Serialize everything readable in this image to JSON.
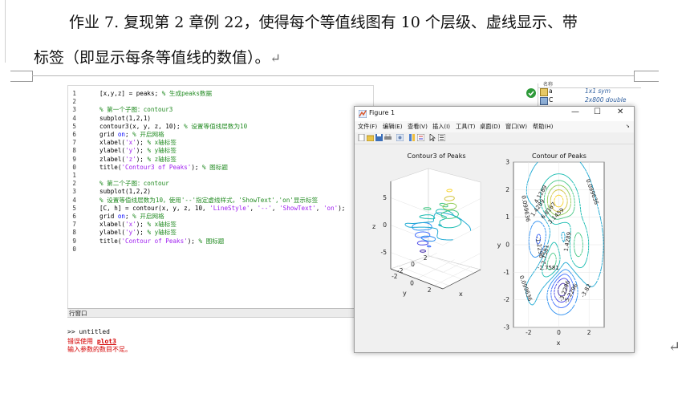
{
  "document": {
    "line1": "作业 7.  复现第 2 章例 22，使得每个等值线图有 10 个层级、虚线显示、带",
    "line2": "标签（即显示每条等值线的数值）。",
    "enter_mark": "↵"
  },
  "editor": {
    "lines": [
      {
        "n": "1",
        "parts": [
          [
            "t",
            "[x,y,z] = peaks; "
          ],
          [
            "c",
            "% 生成peaks数据"
          ]
        ]
      },
      {
        "n": "2",
        "parts": []
      },
      {
        "n": "3",
        "parts": [
          [
            "c",
            "% 第一个子图：contour3"
          ]
        ]
      },
      {
        "n": "4",
        "parts": [
          [
            "t",
            "subplot(1,2,1)"
          ]
        ]
      },
      {
        "n": "5",
        "parts": [
          [
            "t",
            "contour3(x, y, z, 10); "
          ],
          [
            "c",
            "% 设置等值线层数为10"
          ]
        ]
      },
      {
        "n": "6",
        "parts": [
          [
            "t",
            "grid "
          ],
          [
            "k",
            "on"
          ],
          [
            "t",
            "; "
          ],
          [
            "c",
            "% 开启网格"
          ]
        ]
      },
      {
        "n": "7",
        "parts": [
          [
            "t",
            "xlabel("
          ],
          [
            "s",
            "'x'"
          ],
          [
            "t",
            "); "
          ],
          [
            "c",
            "% x轴标签"
          ]
        ]
      },
      {
        "n": "8",
        "parts": [
          [
            "t",
            "ylabel("
          ],
          [
            "s",
            "'y'"
          ],
          [
            "t",
            "); "
          ],
          [
            "c",
            "% y轴标签"
          ]
        ]
      },
      {
        "n": "9",
        "parts": [
          [
            "t",
            "zlabel("
          ],
          [
            "s",
            "'z'"
          ],
          [
            "t",
            "); "
          ],
          [
            "c",
            "% z轴标签"
          ]
        ]
      },
      {
        "n": "0",
        "parts": [
          [
            "t",
            "title("
          ],
          [
            "s",
            "'Contour3 of Peaks'"
          ],
          [
            "t",
            "); "
          ],
          [
            "c",
            "% 图标题"
          ]
        ]
      },
      {
        "n": "1",
        "parts": []
      },
      {
        "n": "2",
        "parts": [
          [
            "c",
            "% 第二个子图：contour"
          ]
        ]
      },
      {
        "n": "3",
        "parts": [
          [
            "t",
            "subplot(1,2,2)"
          ]
        ]
      },
      {
        "n": "4",
        "parts": [
          [
            "c",
            "% 设置等值线层数为10，使用'--'指定虚线样式，'ShowText','on'显示标签"
          ]
        ]
      },
      {
        "n": "5",
        "parts": [
          [
            "t",
            "[C, h] = contour(x, y, z, 10, "
          ],
          [
            "s",
            "'LineStyle'"
          ],
          [
            "t",
            ", "
          ],
          [
            "s",
            "'--'"
          ],
          [
            "t",
            ", "
          ],
          [
            "s",
            "'ShowText'"
          ],
          [
            "t",
            ", "
          ],
          [
            "s",
            "'on'"
          ],
          [
            "t",
            ");"
          ]
        ]
      },
      {
        "n": "6",
        "parts": [
          [
            "t",
            "grid "
          ],
          [
            "k",
            "on"
          ],
          [
            "t",
            "; "
          ],
          [
            "c",
            "% 开启网格"
          ]
        ]
      },
      {
        "n": "7",
        "parts": [
          [
            "t",
            "xlabel("
          ],
          [
            "s",
            "'x'"
          ],
          [
            "t",
            "); "
          ],
          [
            "c",
            "% x轴标签"
          ]
        ]
      },
      {
        "n": "8",
        "parts": [
          [
            "t",
            "ylabel("
          ],
          [
            "s",
            "'y'"
          ],
          [
            "t",
            "); "
          ],
          [
            "c",
            "% y轴标签"
          ]
        ]
      },
      {
        "n": "9",
        "parts": [
          [
            "t",
            "title("
          ],
          [
            "s",
            "'Contour of Peaks'"
          ],
          [
            "t",
            "); "
          ],
          [
            "c",
            "% 图标题"
          ]
        ]
      },
      {
        "n": "0",
        "parts": []
      }
    ]
  },
  "command_window": {
    "label": "行窗口",
    "lines": [
      {
        "text": ">> untitled",
        "color": "#111111"
      },
      {
        "pre": "错误使用 ",
        "link": "plot3",
        "color": "#d40000"
      },
      {
        "text": "输入参数的数目不足。",
        "color": "#d40000"
      }
    ]
  },
  "workspace": {
    "header": "名称",
    "rows": [
      {
        "name": "a",
        "value": "1x1 sym"
      },
      {
        "name": "C",
        "value": "2x800 double"
      }
    ]
  },
  "figure": {
    "title": "Figure 1",
    "menus": [
      "文件(F)",
      "编辑(E)",
      "查看(V)",
      "插入(I)",
      "工具(T)",
      "桌面(D)",
      "窗口(W)",
      "帮助(H)"
    ],
    "toolbar_icons": [
      "new-file-icon",
      "open-folder-icon",
      "save-icon",
      "print-icon",
      "link-icon",
      "colorbar-icon",
      "legend-icon",
      "pointer-icon",
      "property-inspector-icon"
    ],
    "window_buttons": {
      "minimize": "—",
      "maximize": "☐",
      "close": "✕"
    }
  },
  "chart_data": [
    {
      "type": "contour3",
      "title": "Contour3 of Peaks",
      "xlabel": "x",
      "ylabel": "y",
      "zlabel": "z",
      "x_ticks": [
        "-2",
        "0",
        "2"
      ],
      "y_ticks": [
        "-2",
        "0",
        "2"
      ],
      "z_ticks": [
        "-5",
        "0",
        "5"
      ],
      "levels": 10,
      "grid": true
    },
    {
      "type": "contour",
      "title": "Contour of Peaks",
      "xlabel": "x",
      "ylabel": "y",
      "x_ticks": [
        "-2",
        "0",
        "2"
      ],
      "y_ticks": [
        "-3",
        "-2",
        "-1",
        "0",
        "1",
        "2",
        "3"
      ],
      "xlim": [
        -3,
        3
      ],
      "ylim": [
        -3,
        3
      ],
      "levels": 10,
      "line_style": "--",
      "grid": true,
      "contour_labels": [
        "4.1289",
        "1.4289",
        "6.8167",
        "3.1459",
        "0.099636",
        "-1.2296",
        "-2.7581",
        "1.4289",
        "-2.7581",
        "-3.2296",
        "-5.2296",
        "0.099636",
        "0.099636",
        "-3.82"
      ]
    }
  ]
}
